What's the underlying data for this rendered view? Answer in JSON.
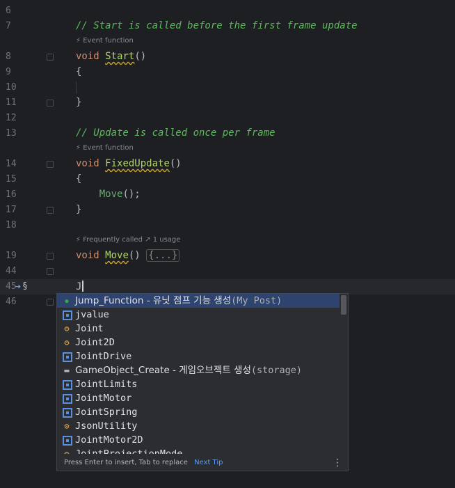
{
  "editor": {
    "lines": [
      {
        "n": "6"
      },
      {
        "n": "7",
        "comment": "// Start is called before the first frame update"
      },
      {
        "hint": "Event function"
      },
      {
        "n": "8",
        "kw": "void",
        "name": "Start",
        "tail": "()"
      },
      {
        "n": "9",
        "text": "{"
      },
      {
        "n": "10"
      },
      {
        "n": "11",
        "text": "}"
      },
      {
        "n": "12"
      },
      {
        "n": "13",
        "comment": "// Update is called once per frame"
      },
      {
        "hint": "Event function"
      },
      {
        "n": "14",
        "kw": "void",
        "name": "FixedUpdate",
        "tail": "()"
      },
      {
        "n": "15",
        "text": "{"
      },
      {
        "n": "16",
        "call": "Move",
        "tail": "();"
      },
      {
        "n": "17",
        "text": "}"
      },
      {
        "n": "18"
      },
      {
        "hint": "Frequently called",
        "hint2": "1 usage"
      },
      {
        "n": "19",
        "kw": "void",
        "name": "Move",
        "tail": "() ",
        "folded": "{...}"
      },
      {
        "n": "44"
      },
      {
        "n": "45",
        "typed": "J"
      },
      {
        "n": "46",
        "text": "}"
      }
    ]
  },
  "completion": {
    "items": [
      {
        "icon": "template",
        "label": "Jump_Function",
        "desc": " - 유닛 점프 기능 생성",
        "source": "(My Post)"
      },
      {
        "icon": "struct",
        "label": "jvalue"
      },
      {
        "icon": "class",
        "label": "Joint"
      },
      {
        "icon": "class",
        "label": "Joint2D"
      },
      {
        "icon": "struct",
        "label": "JointDrive"
      },
      {
        "icon": "folder",
        "label": "GameObject_Create",
        "desc": " - 게임오브젝트 생성",
        "source": "(storage)"
      },
      {
        "icon": "struct",
        "label": "JointLimits"
      },
      {
        "icon": "struct",
        "label": "JointMotor"
      },
      {
        "icon": "struct",
        "label": "JointSpring"
      },
      {
        "icon": "class",
        "label": "JsonUtility"
      },
      {
        "icon": "struct",
        "label": "JointMotor2D"
      },
      {
        "icon": "class",
        "label": "JointProjectionMode"
      }
    ],
    "footer": "Press Enter to insert, Tab to replace",
    "next_tip": "Next Tip",
    "more": "⋮"
  }
}
